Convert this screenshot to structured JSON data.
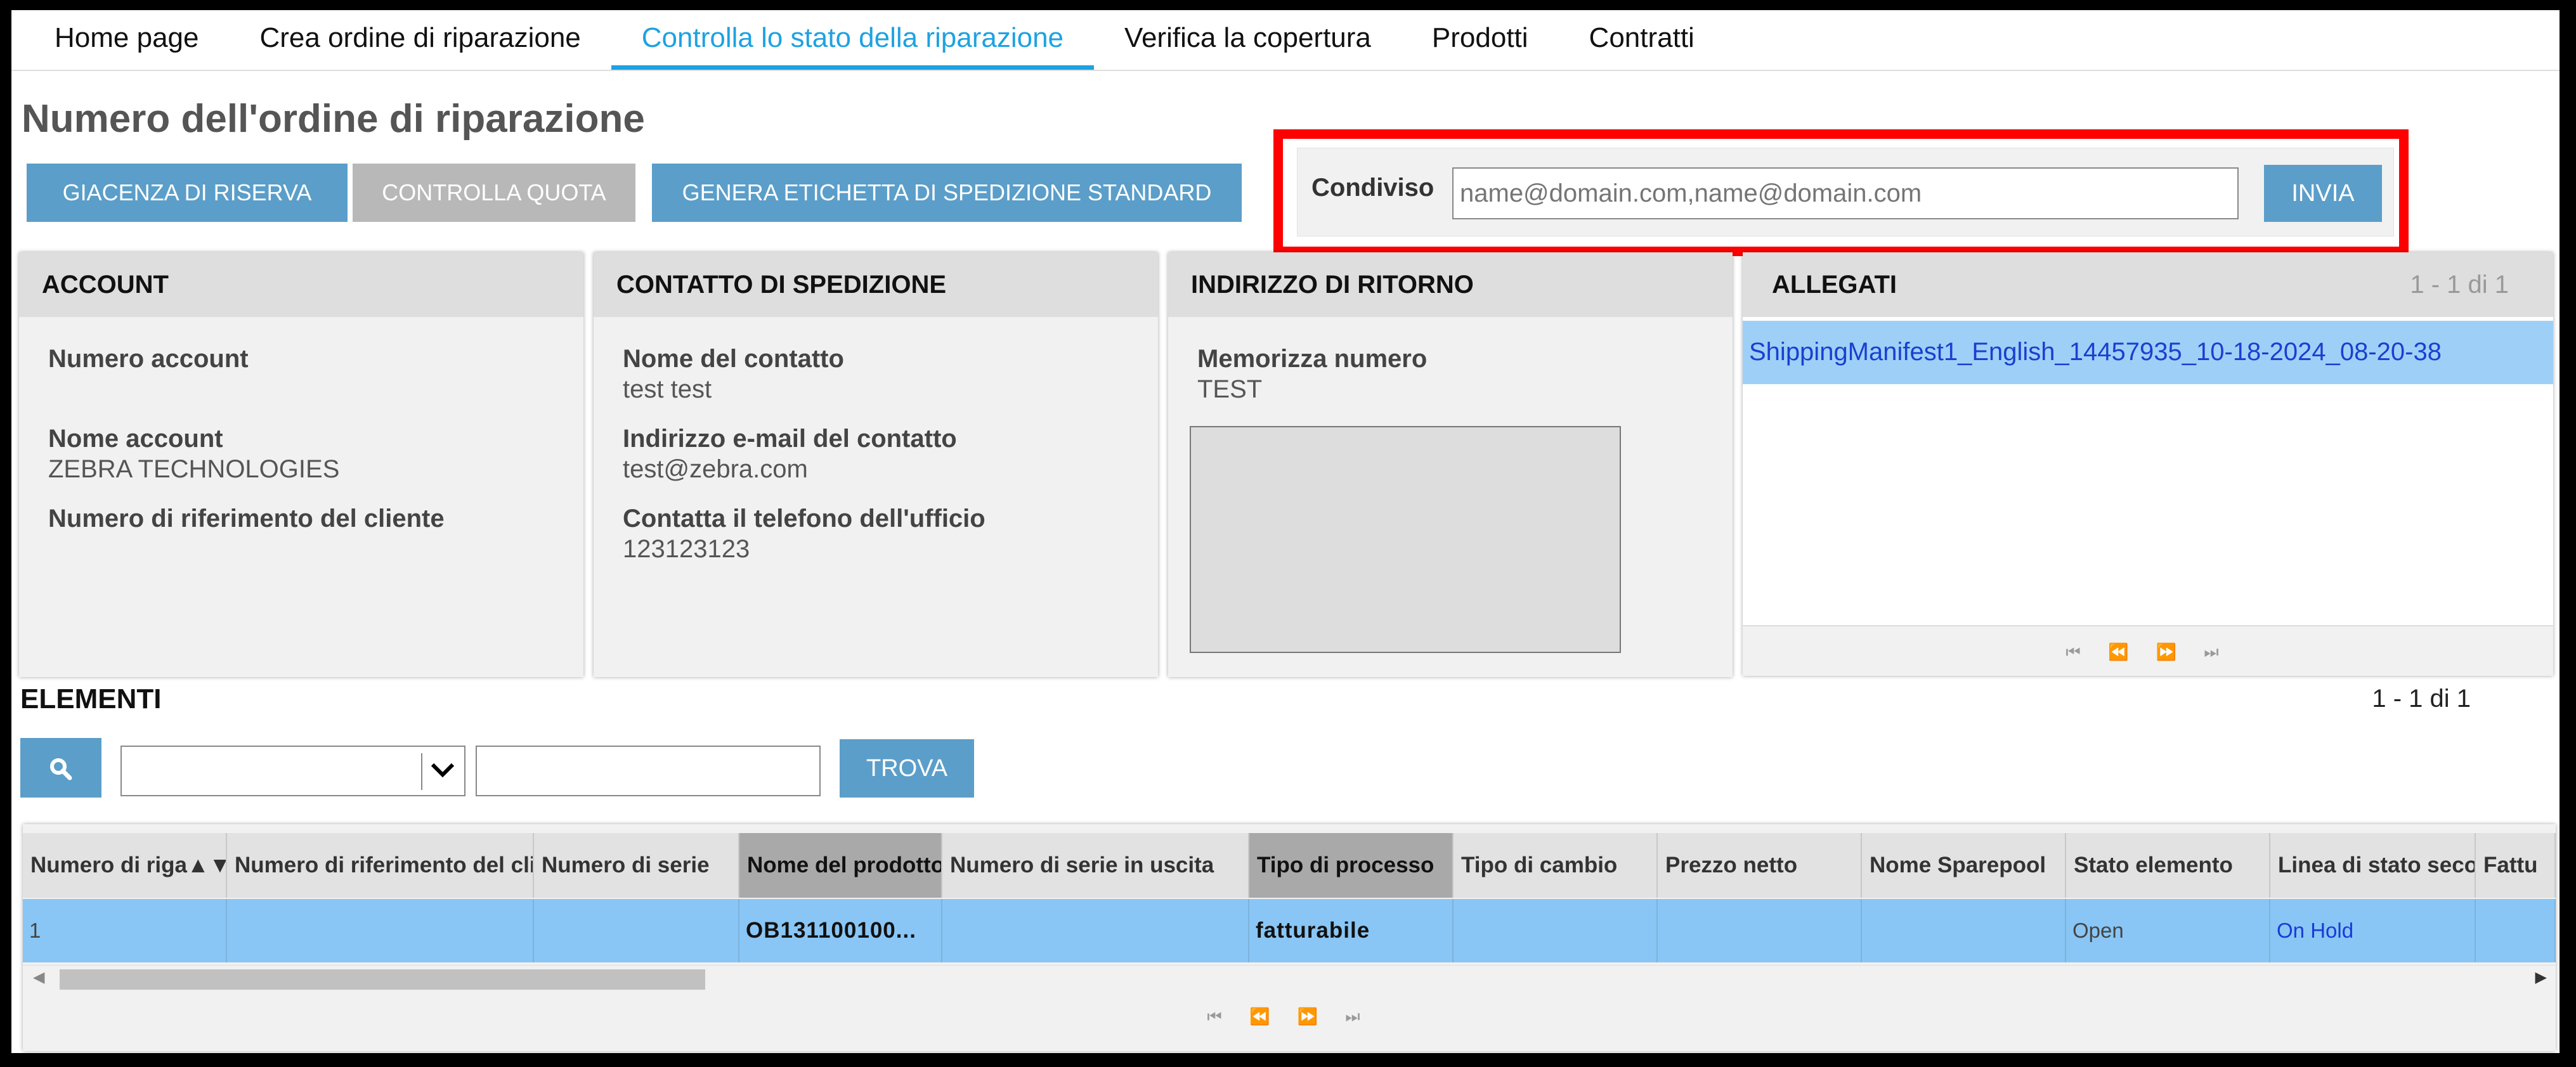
{
  "nav": {
    "tabs": [
      {
        "label": "Home page"
      },
      {
        "label": "Crea ordine di riparazione"
      },
      {
        "label": "Controlla lo stato della riparazione"
      },
      {
        "label": "Verifica la copertura"
      },
      {
        "label": "Prodotti"
      },
      {
        "label": "Contratti"
      }
    ],
    "active_tab": "Controlla lo stato della riparazione",
    "accent_color": "#1ea2e1"
  },
  "page_title": "Numero dell'ordine di riparazione",
  "actions": {
    "reserve_stock": "GIACENZA DI RISERVA",
    "check_quota": "CONTROLLA QUOTA",
    "generate_label": "GENERA ETICHETTA DI SPEDIZIONE STANDARD"
  },
  "share": {
    "label": "Condiviso",
    "placeholder": "name@domain.com,name@domain.com",
    "value": "",
    "submit": "INVIA",
    "highlight_color": "#ff0000"
  },
  "account": {
    "header": "ACCOUNT",
    "account_number_label": "Numero account",
    "account_number_value": "",
    "account_name_label": "Nome account",
    "account_name_value": "ZEBRA TECHNOLOGIES",
    "customer_ref_label": "Numero di riferimento del cliente",
    "customer_ref_value": ""
  },
  "shipping_contact": {
    "header": "CONTATTO DI SPEDIZIONE",
    "name_label": "Nome del contatto",
    "name_value": "test test",
    "email_label": "Indirizzo e-mail del contatto",
    "email_value": "test@zebra.com",
    "phone_label": "Contatta il telefono dell'ufficio",
    "phone_value": "123123123"
  },
  "return_address": {
    "header": "INDIRIZZO DI RITORNO",
    "store_label": "Memorizza numero",
    "store_value": "TEST",
    "address_text": ""
  },
  "attachments": {
    "header": "ALLEGATI",
    "count": "1 - 1 di 1",
    "items": [
      "ShippingManifest1_English_14457935_10-18-2024_08-20-38"
    ],
    "pager": "⏮ ⏪ ⏩ ⏭"
  },
  "elements": {
    "header": "ELEMENTI",
    "count": "1 - 1 di 1",
    "search_icon": "search-icon",
    "filter_value": "",
    "find": "TROVA",
    "columns": [
      "Numero di riga▲▼",
      "Numero di riferimento del clie",
      "Numero di serie",
      "Nome del prodotto",
      "Numero di serie in uscita",
      "Tipo di processo",
      "Tipo di cambio",
      "Prezzo netto",
      "Nome Sparepool",
      "Stato elemento",
      "Linea di stato seco",
      "Fattu"
    ],
    "rows": [
      [
        "1",
        "",
        "",
        "OB131100100...",
        "",
        "fatturabile",
        "",
        "",
        "",
        "Open",
        "On Hold",
        ""
      ]
    ],
    "pager": "⏮ ⏪ ⏩ ⏭"
  }
}
